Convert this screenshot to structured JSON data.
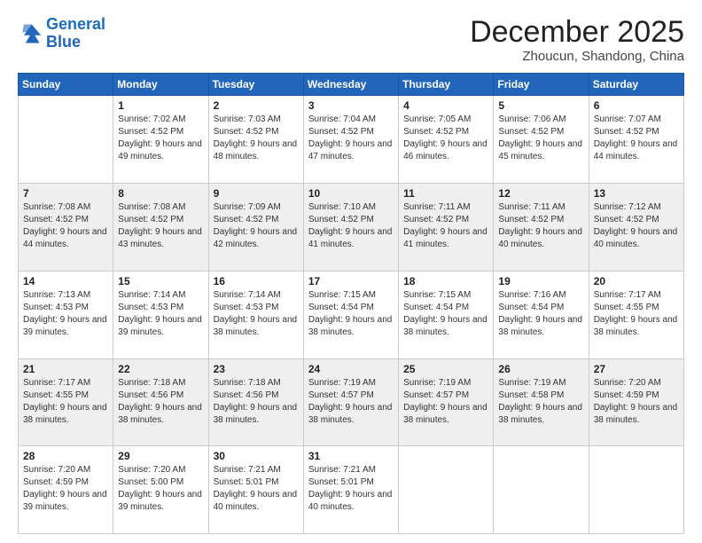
{
  "logo": {
    "line1": "General",
    "line2": "Blue"
  },
  "title": "December 2025",
  "subtitle": "Zhoucun, Shandong, China",
  "days": [
    "Sunday",
    "Monday",
    "Tuesday",
    "Wednesday",
    "Thursday",
    "Friday",
    "Saturday"
  ],
  "weeks": [
    [
      {
        "num": "",
        "sunrise": "",
        "sunset": "",
        "daylight": ""
      },
      {
        "num": "1",
        "sunrise": "Sunrise: 7:02 AM",
        "sunset": "Sunset: 4:52 PM",
        "daylight": "Daylight: 9 hours and 49 minutes."
      },
      {
        "num": "2",
        "sunrise": "Sunrise: 7:03 AM",
        "sunset": "Sunset: 4:52 PM",
        "daylight": "Daylight: 9 hours and 48 minutes."
      },
      {
        "num": "3",
        "sunrise": "Sunrise: 7:04 AM",
        "sunset": "Sunset: 4:52 PM",
        "daylight": "Daylight: 9 hours and 47 minutes."
      },
      {
        "num": "4",
        "sunrise": "Sunrise: 7:05 AM",
        "sunset": "Sunset: 4:52 PM",
        "daylight": "Daylight: 9 hours and 46 minutes."
      },
      {
        "num": "5",
        "sunrise": "Sunrise: 7:06 AM",
        "sunset": "Sunset: 4:52 PM",
        "daylight": "Daylight: 9 hours and 45 minutes."
      },
      {
        "num": "6",
        "sunrise": "Sunrise: 7:07 AM",
        "sunset": "Sunset: 4:52 PM",
        "daylight": "Daylight: 9 hours and 44 minutes."
      }
    ],
    [
      {
        "num": "7",
        "sunrise": "Sunrise: 7:08 AM",
        "sunset": "Sunset: 4:52 PM",
        "daylight": "Daylight: 9 hours and 44 minutes."
      },
      {
        "num": "8",
        "sunrise": "Sunrise: 7:08 AM",
        "sunset": "Sunset: 4:52 PM",
        "daylight": "Daylight: 9 hours and 43 minutes."
      },
      {
        "num": "9",
        "sunrise": "Sunrise: 7:09 AM",
        "sunset": "Sunset: 4:52 PM",
        "daylight": "Daylight: 9 hours and 42 minutes."
      },
      {
        "num": "10",
        "sunrise": "Sunrise: 7:10 AM",
        "sunset": "Sunset: 4:52 PM",
        "daylight": "Daylight: 9 hours and 41 minutes."
      },
      {
        "num": "11",
        "sunrise": "Sunrise: 7:11 AM",
        "sunset": "Sunset: 4:52 PM",
        "daylight": "Daylight: 9 hours and 41 minutes."
      },
      {
        "num": "12",
        "sunrise": "Sunrise: 7:11 AM",
        "sunset": "Sunset: 4:52 PM",
        "daylight": "Daylight: 9 hours and 40 minutes."
      },
      {
        "num": "13",
        "sunrise": "Sunrise: 7:12 AM",
        "sunset": "Sunset: 4:52 PM",
        "daylight": "Daylight: 9 hours and 40 minutes."
      }
    ],
    [
      {
        "num": "14",
        "sunrise": "Sunrise: 7:13 AM",
        "sunset": "Sunset: 4:53 PM",
        "daylight": "Daylight: 9 hours and 39 minutes."
      },
      {
        "num": "15",
        "sunrise": "Sunrise: 7:14 AM",
        "sunset": "Sunset: 4:53 PM",
        "daylight": "Daylight: 9 hours and 39 minutes."
      },
      {
        "num": "16",
        "sunrise": "Sunrise: 7:14 AM",
        "sunset": "Sunset: 4:53 PM",
        "daylight": "Daylight: 9 hours and 38 minutes."
      },
      {
        "num": "17",
        "sunrise": "Sunrise: 7:15 AM",
        "sunset": "Sunset: 4:54 PM",
        "daylight": "Daylight: 9 hours and 38 minutes."
      },
      {
        "num": "18",
        "sunrise": "Sunrise: 7:15 AM",
        "sunset": "Sunset: 4:54 PM",
        "daylight": "Daylight: 9 hours and 38 minutes."
      },
      {
        "num": "19",
        "sunrise": "Sunrise: 7:16 AM",
        "sunset": "Sunset: 4:54 PM",
        "daylight": "Daylight: 9 hours and 38 minutes."
      },
      {
        "num": "20",
        "sunrise": "Sunrise: 7:17 AM",
        "sunset": "Sunset: 4:55 PM",
        "daylight": "Daylight: 9 hours and 38 minutes."
      }
    ],
    [
      {
        "num": "21",
        "sunrise": "Sunrise: 7:17 AM",
        "sunset": "Sunset: 4:55 PM",
        "daylight": "Daylight: 9 hours and 38 minutes."
      },
      {
        "num": "22",
        "sunrise": "Sunrise: 7:18 AM",
        "sunset": "Sunset: 4:56 PM",
        "daylight": "Daylight: 9 hours and 38 minutes."
      },
      {
        "num": "23",
        "sunrise": "Sunrise: 7:18 AM",
        "sunset": "Sunset: 4:56 PM",
        "daylight": "Daylight: 9 hours and 38 minutes."
      },
      {
        "num": "24",
        "sunrise": "Sunrise: 7:19 AM",
        "sunset": "Sunset: 4:57 PM",
        "daylight": "Daylight: 9 hours and 38 minutes."
      },
      {
        "num": "25",
        "sunrise": "Sunrise: 7:19 AM",
        "sunset": "Sunset: 4:57 PM",
        "daylight": "Daylight: 9 hours and 38 minutes."
      },
      {
        "num": "26",
        "sunrise": "Sunrise: 7:19 AM",
        "sunset": "Sunset: 4:58 PM",
        "daylight": "Daylight: 9 hours and 38 minutes."
      },
      {
        "num": "27",
        "sunrise": "Sunrise: 7:20 AM",
        "sunset": "Sunset: 4:59 PM",
        "daylight": "Daylight: 9 hours and 38 minutes."
      }
    ],
    [
      {
        "num": "28",
        "sunrise": "Sunrise: 7:20 AM",
        "sunset": "Sunset: 4:59 PM",
        "daylight": "Daylight: 9 hours and 39 minutes."
      },
      {
        "num": "29",
        "sunrise": "Sunrise: 7:20 AM",
        "sunset": "Sunset: 5:00 PM",
        "daylight": "Daylight: 9 hours and 39 minutes."
      },
      {
        "num": "30",
        "sunrise": "Sunrise: 7:21 AM",
        "sunset": "Sunset: 5:01 PM",
        "daylight": "Daylight: 9 hours and 40 minutes."
      },
      {
        "num": "31",
        "sunrise": "Sunrise: 7:21 AM",
        "sunset": "Sunset: 5:01 PM",
        "daylight": "Daylight: 9 hours and 40 minutes."
      },
      {
        "num": "",
        "sunrise": "",
        "sunset": "",
        "daylight": ""
      },
      {
        "num": "",
        "sunrise": "",
        "sunset": "",
        "daylight": ""
      },
      {
        "num": "",
        "sunrise": "",
        "sunset": "",
        "daylight": ""
      }
    ]
  ]
}
